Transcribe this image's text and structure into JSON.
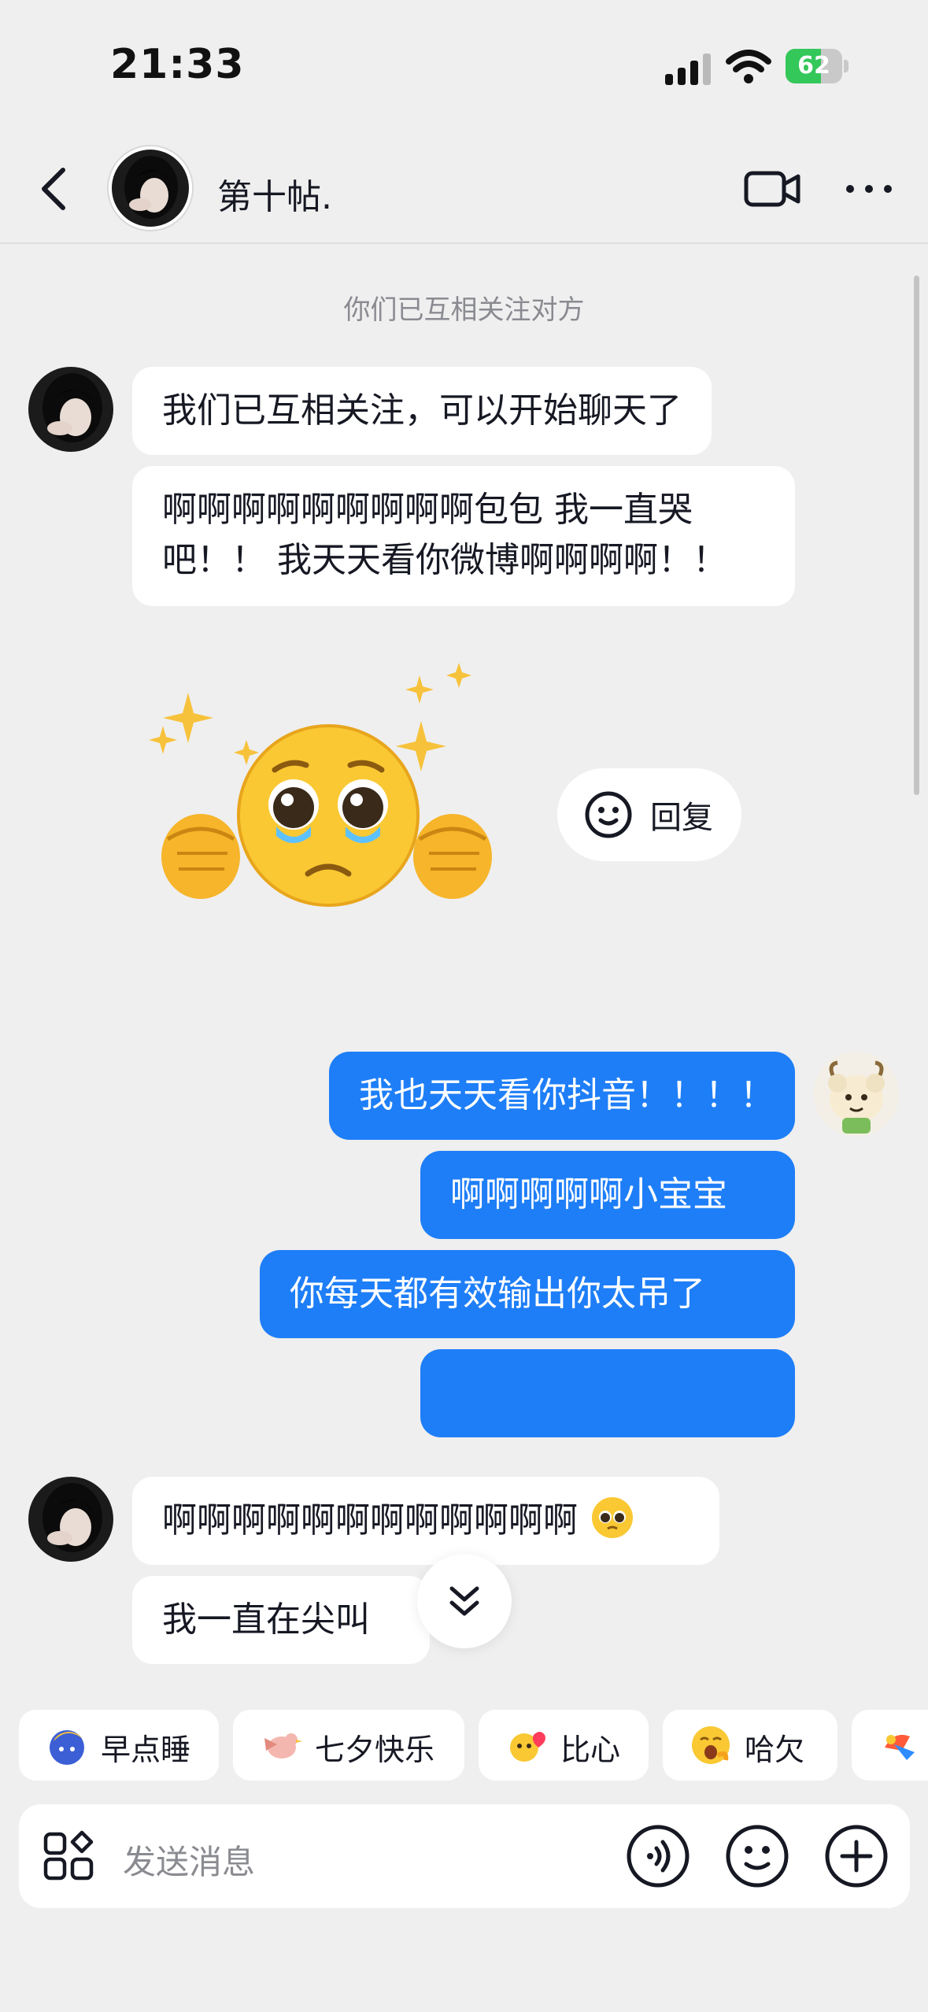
{
  "status_bar": {
    "time": "21:33",
    "battery_level": "62",
    "battery_percent": 62
  },
  "header": {
    "contact_name": "第十帖.",
    "icons": [
      "back-arrow-icon",
      "video-call-icon",
      "more-icon"
    ]
  },
  "chat": {
    "system_note": "你们已互相关注对方",
    "messages_in_1": [
      "我们已互相关注，可以开始聊天了",
      "啊啊啊啊啊啊啊啊啊包包 我一直哭",
      "吧！！ 我天天看你微博啊啊啊啊！！"
    ],
    "sticker": "pleading-face-sticker",
    "reply_button": "回复",
    "messages_out": [
      "我也天天看你抖音！！！！",
      "啊啊啊啊啊小宝宝",
      "你每天都有效输出你太吊了",
      ""
    ],
    "messages_in_2": [
      "啊啊啊啊啊啊啊啊啊啊啊啊",
      "我一直在尖叫"
    ]
  },
  "quick_replies": [
    "早点睡",
    "七夕快乐",
    "比心",
    "哈欠"
  ],
  "input": {
    "placeholder": "发送消息"
  },
  "colors": {
    "background": "#efefef",
    "outgoing_bubble": "#1e7ef7",
    "incoming_bubble": "#ffffff",
    "battery": "#34c759"
  }
}
